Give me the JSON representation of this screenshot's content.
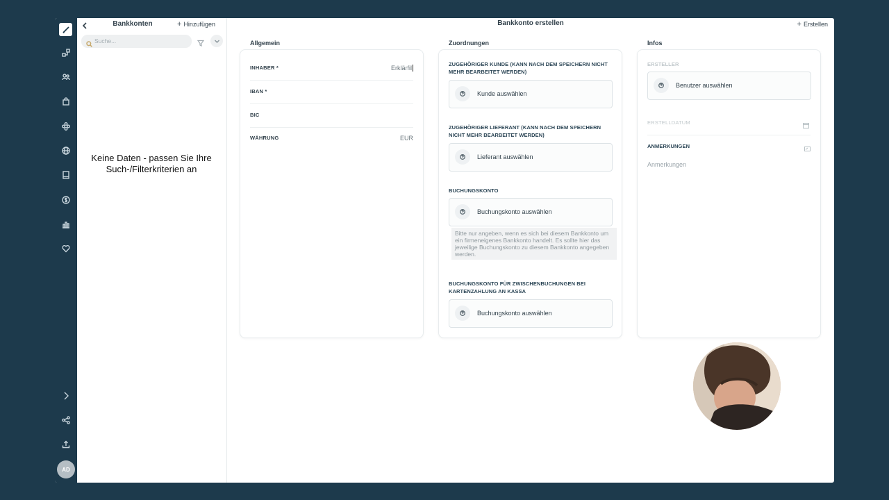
{
  "rail": {
    "icons": [
      "pen-icon",
      "workflow-icon",
      "users-icon",
      "shopping-bag-icon",
      "modules-icon",
      "globe-icon",
      "book-icon",
      "dollar-icon",
      "bar-chart-icon",
      "heart-icon",
      "chevron-right-icon",
      "share-icon",
      "upload-icon"
    ],
    "avatar": "AD"
  },
  "list_panel": {
    "title": "Bankkonten",
    "add_label": "Hinzufügen",
    "search_placeholder": "Suche...",
    "empty_message": "Keine Daten - passen Sie Ihre Such-/Filterkriterien an"
  },
  "header": {
    "title": "Bankkonto erstellen",
    "create_label": "Erstellen"
  },
  "allgemein": {
    "title": "Allgemein",
    "fields": [
      {
        "label": "INHABER *",
        "value": "Erklärfil"
      },
      {
        "label": "IBAN *",
        "value": ""
      },
      {
        "label": "BIC",
        "value": ""
      },
      {
        "label": "WÄHRUNG",
        "value": "EUR"
      }
    ]
  },
  "zuordnungen": {
    "title": "Zuordnungen",
    "kunde": {
      "label": "ZUGEHÖRIGER KUNDE (KANN NACH DEM SPEICHERN NICHT MEHR BEARBEITET WERDEN)",
      "select": "Kunde auswählen"
    },
    "lieferant": {
      "label": "ZUGEHÖRIGER LIEFERANT (KANN NACH DEM SPEICHERN NICHT MEHR BEARBEITET WERDEN)",
      "select": "Lieferant auswählen"
    },
    "buchungskonto": {
      "label": "BUCHUNGSKONTO",
      "select": "Buchungskonto auswählen",
      "hint": "Bitte nur angeben, wenn es sich bei diesem Bankkonto um ein firmeneigenes Bankkonto handelt. Es sollte hier das jeweilige Buchungskonto zu diesem Bankkonto angegeben werden."
    },
    "zwischen": {
      "label": "BUCHUNGSKONTO FÜR ZWISCHENBUCHUNGEN BEI KARTENZAHLUNG AN KASSA",
      "select": "Buchungskonto auswählen"
    }
  },
  "infos": {
    "title": "Infos",
    "ersteller_label": "ERSTELLER",
    "ersteller_select": "Benutzer auswählen",
    "erstelldatum_label": "ERSTELLDATUM",
    "anmerkungen_label": "ANMERKUNGEN",
    "anmerkungen_placeholder": "Anmerkungen"
  }
}
